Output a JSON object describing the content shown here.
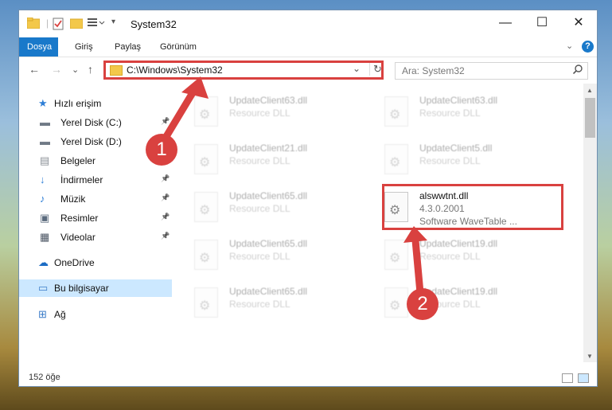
{
  "window": {
    "title": "System32",
    "controls": {
      "minimize": "—",
      "maximize": "☐",
      "close": "✕"
    }
  },
  "ribbon": {
    "tabs": [
      "Dosya",
      "Giriş",
      "Paylaş",
      "Görünüm"
    ],
    "active_tab": "Dosya",
    "help_label": "?",
    "collapse_label": "⌄"
  },
  "address": {
    "path": "C:\\Windows\\System32",
    "dropdown_glyph": "⌄",
    "refresh_glyph": "↻"
  },
  "search": {
    "placeholder": "Ara: System32",
    "icon": "search-icon"
  },
  "nav": {
    "back": "←",
    "forward": "→",
    "recent": "⌄",
    "up": "↑"
  },
  "sidebar": {
    "items": [
      {
        "label": "Hızlı erişim",
        "icon": "star-icon",
        "pinned": false,
        "selected": false
      },
      {
        "label": "Yerel Disk (C:)",
        "icon": "drive-icon",
        "pinned": true,
        "selected": false
      },
      {
        "label": "Yerel Disk (D:)",
        "icon": "drive-icon",
        "pinned": true,
        "selected": false
      },
      {
        "label": "Belgeler",
        "icon": "document-icon",
        "pinned": true,
        "selected": false
      },
      {
        "label": "İndirmeler",
        "icon": "download-icon",
        "pinned": true,
        "selected": false
      },
      {
        "label": "Müzik",
        "icon": "music-icon",
        "pinned": true,
        "selected": false
      },
      {
        "label": "Resimler",
        "icon": "pictures-icon",
        "pinned": true,
        "selected": false
      },
      {
        "label": "Videolar",
        "icon": "video-icon",
        "pinned": true,
        "selected": false
      },
      {
        "label": "OneDrive",
        "icon": "cloud-icon",
        "pinned": false,
        "selected": false
      },
      {
        "label": "Bu bilgisayar",
        "icon": "computer-icon",
        "pinned": false,
        "selected": true
      },
      {
        "label": "Ağ",
        "icon": "network-icon",
        "pinned": false,
        "selected": false
      }
    ]
  },
  "files": [
    {
      "name": "UpdateClient63.dll",
      "type": "Resource DLL",
      "faded": true
    },
    {
      "name": "UpdateClient63.dll",
      "type": "Resource DLL",
      "faded": true
    },
    {
      "name": "UpdateClient21.dll",
      "type": "Resource DLL",
      "faded": true
    },
    {
      "name": "UpdateClient5.dll",
      "type": "Resource DLL",
      "faded": true
    },
    {
      "name": "UpdateClient65.dll",
      "type": "Resource DLL",
      "faded": true
    },
    {
      "name": "alswwtnt.dll",
      "version": "4.3.0.2001",
      "type": "Software WaveTable ...",
      "faded": false,
      "highlighted": true
    },
    {
      "name": "UpdateClient65.dll",
      "type": "Resource DLL",
      "faded": true
    },
    {
      "name": "UpdateClient19.dll",
      "type": "Resource DLL",
      "faded": true
    },
    {
      "name": "UpdateClient65.dll",
      "type": "Resource DLL",
      "faded": true
    },
    {
      "name": "UpdateClient19.dll",
      "type": "Resource DLL",
      "faded": true
    }
  ],
  "status": {
    "count_text": "152 öğe"
  },
  "annotations": {
    "badge1": "1",
    "badge2": "2",
    "color": "#d9413f"
  },
  "colors": {
    "accent": "#1979ca",
    "selection": "#cce8ff",
    "highlight": "#d9413f"
  }
}
